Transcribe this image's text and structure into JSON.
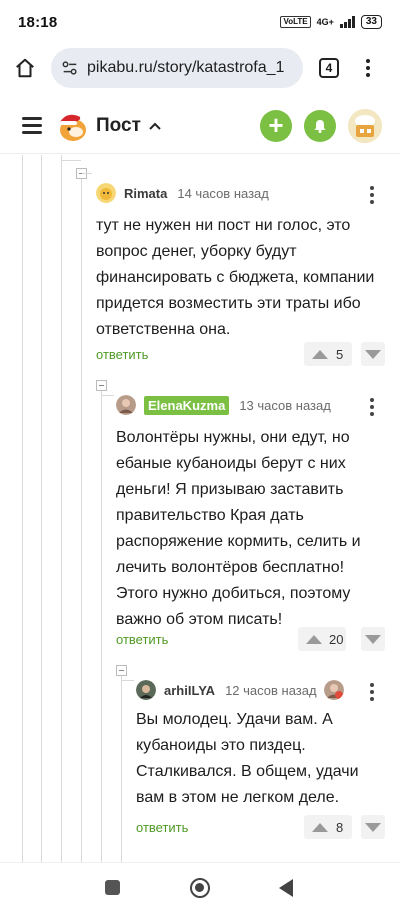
{
  "status_bar": {
    "time": "18:18",
    "vo_label": "VoLTE",
    "network": "4G+",
    "battery": "33"
  },
  "browser": {
    "url": "pikabu.ru/story/katastrofa_1",
    "tab_count": "4"
  },
  "header": {
    "title": "Пост"
  },
  "comments": [
    {
      "author": "Rimata",
      "time": "14 часов назад",
      "text": "тут не нужен ни пост ни голос, это вопрос денег, уборку будут финансировать с бюджета, компании придется возместить эти траты ибо ответственна она.",
      "reply_label": "ответить",
      "votes": "5"
    },
    {
      "author": "ElenaKuzma",
      "time": "13 часов назад",
      "text": "Волонтёры нужны, они едут, но ебаные кубаноиды берут с них деньги! Я призываю заставить правительство Края дать распоряжение кормить, селить и лечить волонтёров бесплатно! Этого нужно добиться, поэтому важно об этом писать!",
      "reply_label": "ответить",
      "votes": "20"
    },
    {
      "author": "arhiILYA",
      "time": "12 часов назад",
      "text": "Вы молодец. Удачи вам. А кубаноиды это пиздец. Сталкивался. В общем, удачи вам в этом не легком деле.",
      "reply_label": "ответить",
      "votes": "8"
    }
  ],
  "colors": {
    "accent_green": "#7bc043",
    "link_green": "#4f9a25"
  }
}
